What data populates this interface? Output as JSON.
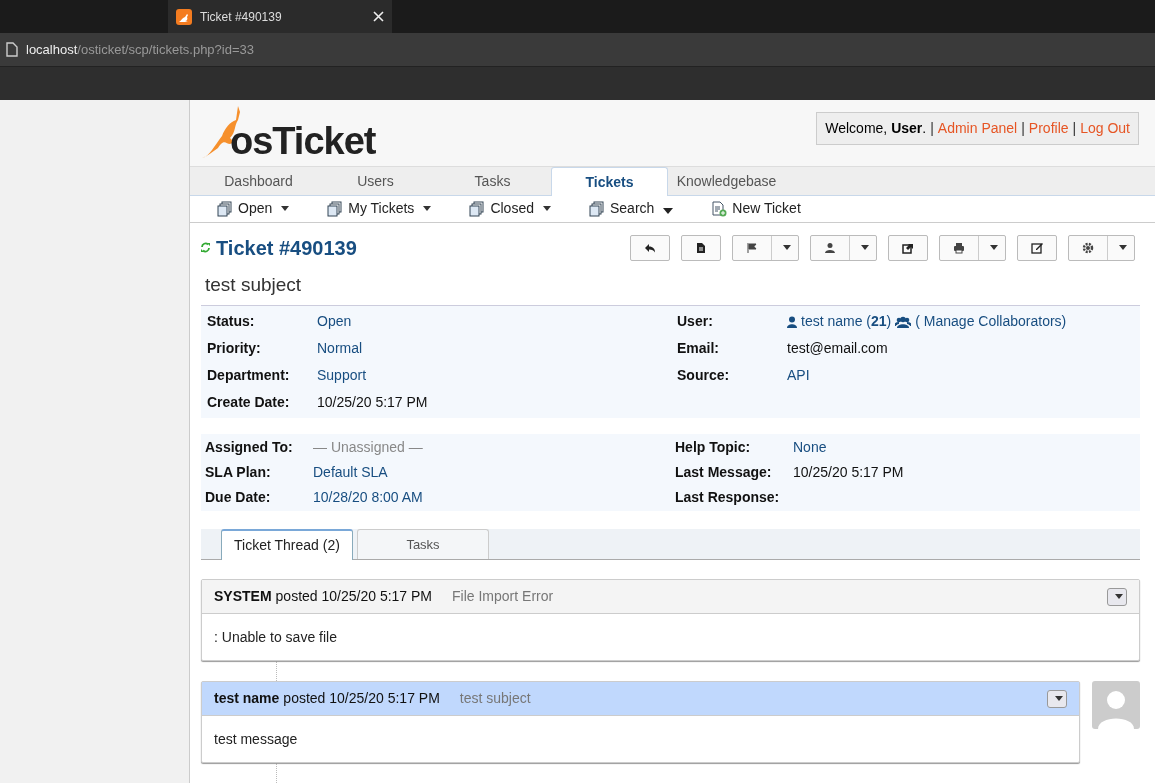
{
  "browser": {
    "tab_title": "Ticket #490139",
    "url_host": "localhost",
    "url_path": "/osticket/scp/tickets.php?id=33"
  },
  "header": {
    "logo": "osTicket",
    "welcome": "Welcome, **User**.",
    "links": [
      {
        "separator": "|",
        "label": "Admin Panel"
      },
      {
        "separator": "|",
        "label": "Profile"
      },
      {
        "separator": "|",
        "label": "Log Out"
      }
    ]
  },
  "nav_tabs": [
    {
      "label": "Dashboard",
      "selected": false
    },
    {
      "label": "Users",
      "selected": false
    },
    {
      "label": "Tasks",
      "selected": false
    },
    {
      "label": "Tickets",
      "selected": true
    },
    {
      "label": "Knowledgebase",
      "selected": false
    }
  ],
  "sub_nav": [
    {
      "label": "Open",
      "kind": "queue"
    },
    {
      "label": "My Tickets",
      "kind": "queue"
    },
    {
      "label": "Closed",
      "kind": "queue"
    },
    {
      "label": "Search",
      "kind": "search"
    },
    {
      "label": "New Ticket",
      "kind": "new"
    }
  ],
  "ticket": {
    "number": "Ticket #490139",
    "subject": "test subject",
    "actions": [
      {
        "kind": "reply",
        "dropdown": false
      },
      {
        "kind": "note",
        "dropdown": false
      },
      {
        "kind": "flag",
        "dropdown": true
      },
      {
        "kind": "user",
        "dropdown": true
      },
      {
        "kind": "share",
        "dropdown": false
      },
      {
        "kind": "print",
        "dropdown": true
      },
      {
        "kind": "edit",
        "dropdown": false
      },
      {
        "kind": "gear",
        "dropdown": true
      }
    ],
    "info_left": [
      {
        "label": "Status:",
        "value": "Open",
        "kind": "link"
      },
      {
        "label": "Priority:",
        "value": "Normal",
        "kind": "link"
      },
      {
        "label": "Department:",
        "value": "Support",
        "kind": "link"
      },
      {
        "label": "Create Date:",
        "value": "10/25/20 5:17 PM",
        "kind": "plain"
      }
    ],
    "info_right": [
      {
        "label": "User:",
        "value": "test name (**21**)",
        "extra": "( Manage Collaborators)",
        "kind": "user"
      },
      {
        "label": "Email:",
        "value": "test@email.com",
        "kind": "plain"
      },
      {
        "label": "Source:",
        "value": "API",
        "kind": "link"
      }
    ],
    "assign_left": [
      {
        "label": "Assigned To:",
        "value": "— Unassigned —",
        "kind": "muted"
      },
      {
        "label": "SLA Plan:",
        "value": "Default SLA",
        "kind": "link"
      },
      {
        "label": "Due Date:",
        "value": "10/28/20 8:00 AM",
        "kind": "link"
      }
    ],
    "assign_right": [
      {
        "label": "Help Topic:",
        "value": "None",
        "kind": "link"
      },
      {
        "label": "Last Message:",
        "value": "10/25/20 5:17 PM",
        "kind": "plain"
      },
      {
        "label": "Last Response:"
      }
    ]
  },
  "thread_tabs": [
    {
      "label": "Ticket Thread (2)",
      "selected": true
    },
    {
      "label": "Tasks",
      "selected": false
    }
  ],
  "entries": [
    {
      "kind": "system",
      "author": "SYSTEM",
      "posted": "posted 10/25/20 5:17 PM",
      "title": "File Import Error",
      "body": ": Unable to save file"
    },
    {
      "kind": "message",
      "author": "test name",
      "posted": "posted 10/25/20 5:17 PM",
      "title": "test subject",
      "body": "test message"
    }
  ]
}
